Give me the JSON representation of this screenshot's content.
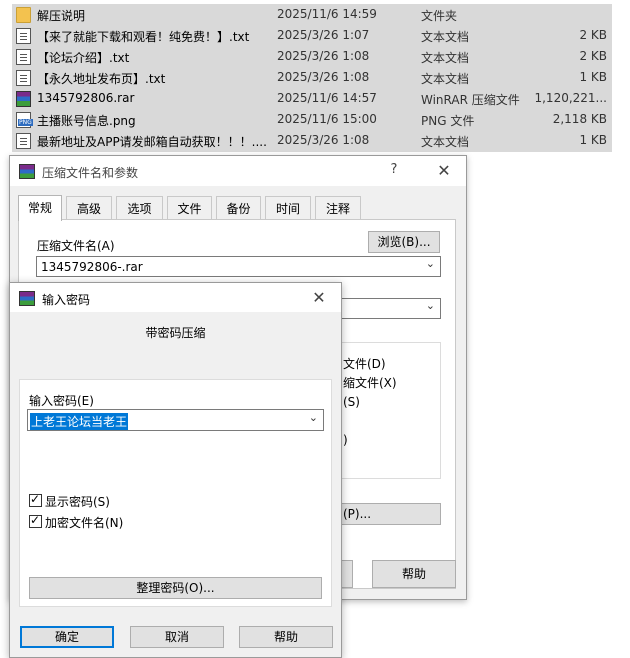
{
  "files": [
    {
      "icon": "folder-icon",
      "name": "解压说明",
      "date": "2025/11/6 14:59",
      "type": "文件夹",
      "size": ""
    },
    {
      "icon": "txt-file-icon",
      "name": "【来了就能下载和观看！纯免费！】.txt",
      "date": "2025/3/26 1:07",
      "type": "文本文档",
      "size": "2 KB"
    },
    {
      "icon": "txt-file-icon",
      "name": "【论坛介绍】.txt",
      "date": "2025/3/26 1:08",
      "type": "文本文档",
      "size": "2 KB"
    },
    {
      "icon": "txt-file-icon",
      "name": "【永久地址发布页】.txt",
      "date": "2025/3/26 1:08",
      "type": "文本文档",
      "size": "1 KB"
    },
    {
      "icon": "rar-file-icon",
      "name": "1345792806.rar",
      "date": "2025/11/6 14:57",
      "type": "WinRAR 压缩文件",
      "size": "1,120,221..."
    },
    {
      "icon": "png-file-icon",
      "name": "主播账号信息.png",
      "date": "2025/11/6 15:00",
      "type": "PNG 文件",
      "size": "2,118 KB"
    },
    {
      "icon": "txt-file-icon",
      "name": "最新地址及APP请发邮箱自动获取！！！....",
      "date": "2025/3/26 1:08",
      "type": "文本文档",
      "size": "1 KB"
    }
  ],
  "main_dialog": {
    "title": "压缩文件名和参数",
    "help": "?",
    "close": "✕",
    "tabs": [
      "常规",
      "高级",
      "选项",
      "文件",
      "备份",
      "时间",
      "注释"
    ],
    "archive_name_label": "压缩文件名(A)",
    "browse_button": "浏览(B)...",
    "archive_name_value": "1345792806-.rar",
    "options_partial": [
      "文件(D)",
      "缩文件(X)",
      "(S)",
      ")"
    ],
    "password_button_partial": "(P)...",
    "help_button": "帮助"
  },
  "password_dialog": {
    "title": "输入密码",
    "close": "✕",
    "heading": "带密码压缩",
    "password_label": "输入密码(E)",
    "password_value": "上老王论坛当老王",
    "show_password_label": "显示密码(S)",
    "encrypt_names_label": "加密文件名(N)",
    "organize_button": "整理密码(O)...",
    "ok_button": "确定",
    "cancel_button": "取消",
    "help_button": "帮助"
  }
}
